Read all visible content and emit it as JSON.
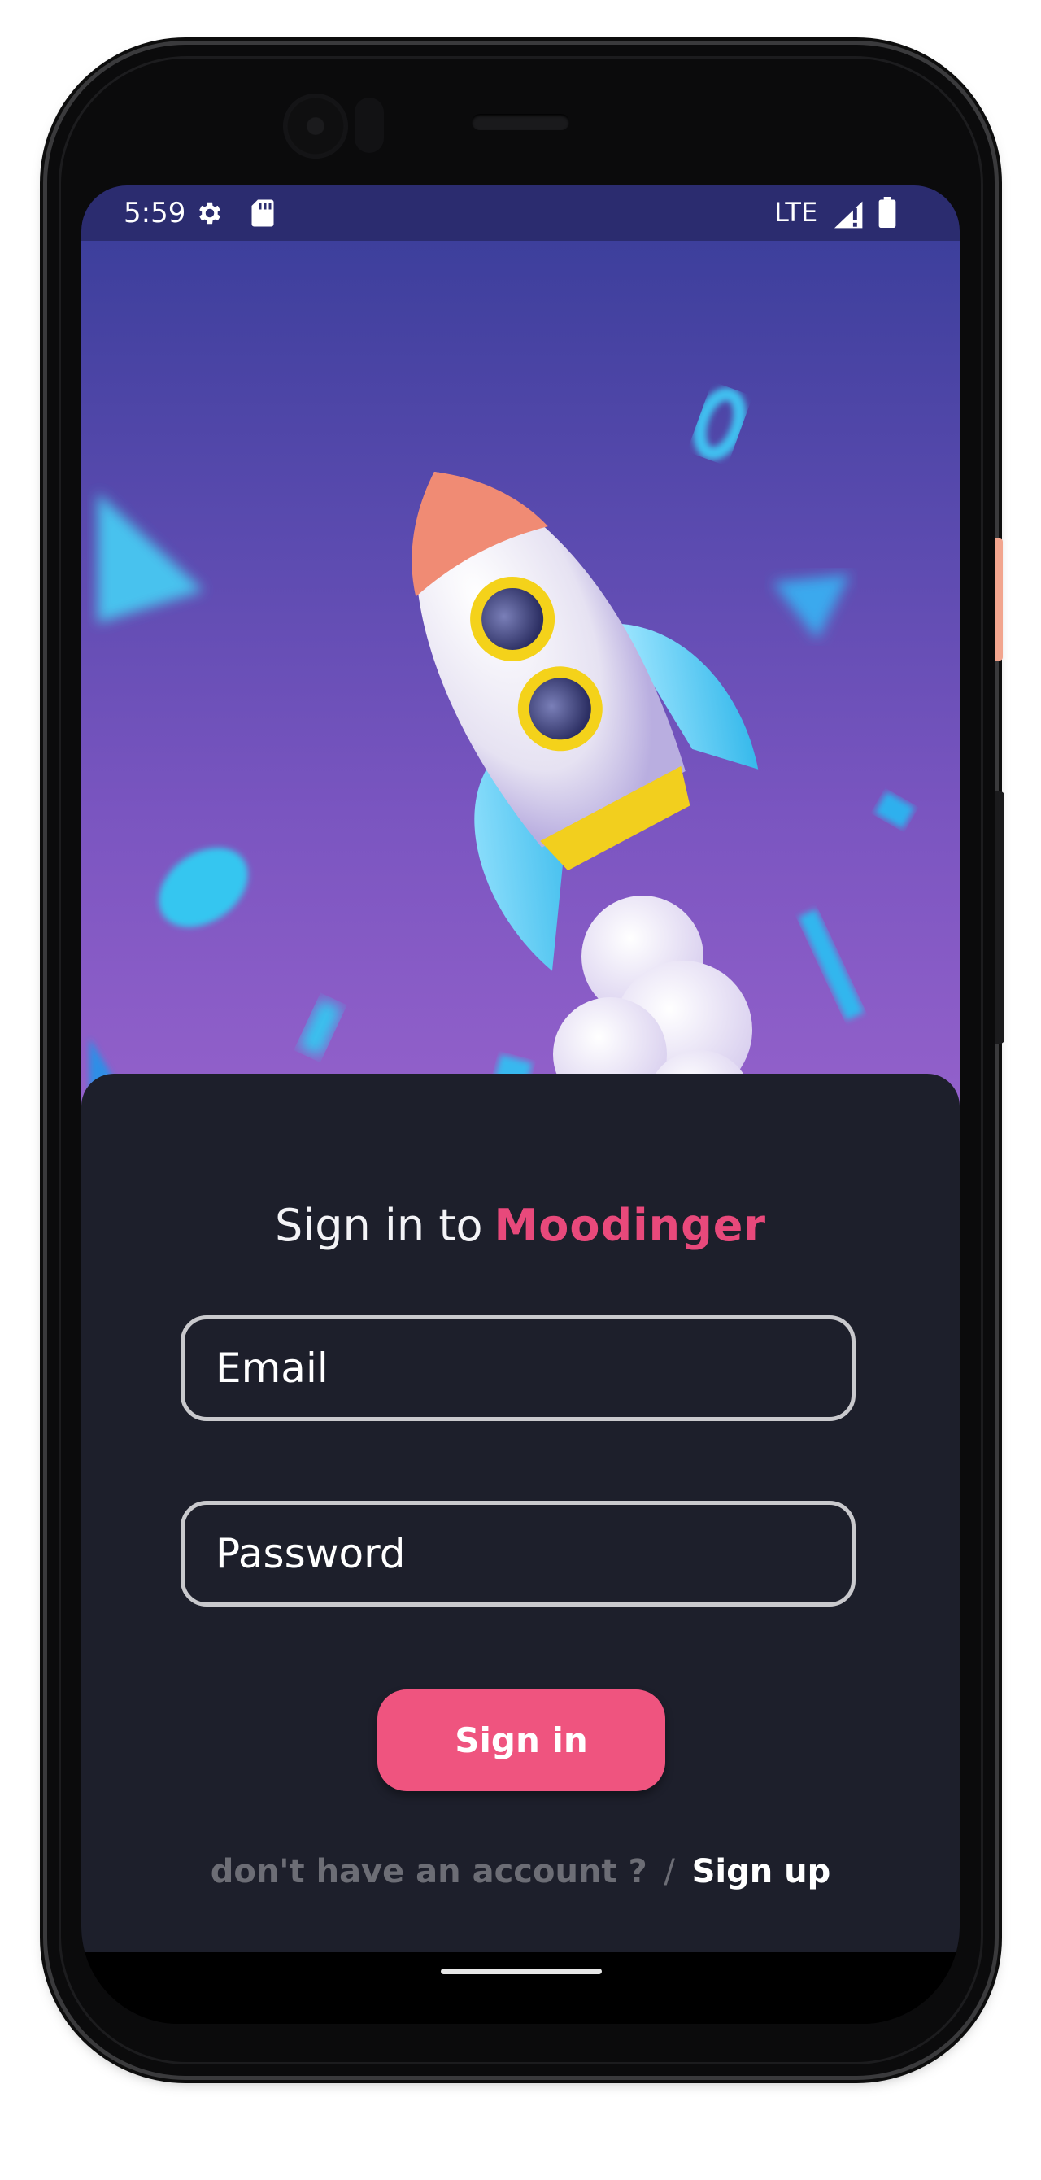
{
  "status_bar": {
    "time": "5:59",
    "network": "LTE",
    "icons": [
      "settings-gear-icon",
      "sd-card-icon",
      "signal-icon",
      "battery-icon"
    ]
  },
  "hero": {
    "illustration": "rocket-illustration"
  },
  "login": {
    "title_prefix": "Sign in to",
    "brand_name": "Moodinger",
    "email_placeholder": "Email",
    "password_placeholder": "Password",
    "signin_label": "Sign in",
    "signup_prompt": "don't have an account ?",
    "separator": "/",
    "signup_label": "Sign up"
  },
  "colors": {
    "accent": "#ef547f",
    "brand_text": "#e8497b",
    "card_bg": "#1d1f2b",
    "status_bar_bg": "#2b2c6f"
  }
}
